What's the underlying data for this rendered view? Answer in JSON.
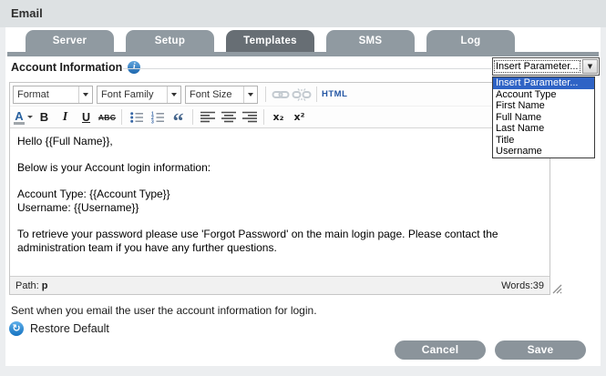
{
  "window": {
    "title": "Email"
  },
  "tabs": [
    {
      "label": "Server",
      "active": false
    },
    {
      "label": "Setup",
      "active": false
    },
    {
      "label": "Templates",
      "active": true
    },
    {
      "label": "SMS",
      "active": false
    },
    {
      "label": "Log",
      "active": false
    }
  ],
  "section": {
    "title": "Account Information"
  },
  "parameter_select": {
    "value": "Insert Parameter...",
    "options": [
      "Insert Parameter...",
      "Account Type",
      "First Name",
      "Full Name",
      "Last Name",
      "Title",
      "Username"
    ],
    "highlighted_option": "Insert Parameter..."
  },
  "editor_toolbar": {
    "format_select": "Format",
    "font_family_select": "Font Family",
    "font_size_select": "Font Size",
    "html_button": "HTML",
    "color_letter": "A",
    "bold": "B",
    "italic": "I",
    "underline": "U",
    "strikethrough": "ABC",
    "blockquote": "“",
    "subscript": "x₂",
    "superscript": "x²"
  },
  "editor": {
    "content": "Hello {{Full Name}},\n\nBelow is your Account login information:\n\nAccount Type: {{Account Type}}\nUsername: {{Username}}\n\nTo retrieve your password please use 'Forgot Password' on the main login page. Please contact the\nadministration team if you have any further questions.",
    "status_path_label": "Path: ",
    "status_path_value": "p",
    "word_count": "Words:39"
  },
  "footer": {
    "description": "Sent when you email the user the account information for login.",
    "restore_default_label": "Restore Default",
    "restore_icon_glyph": "↻",
    "cancel_button": "Cancel",
    "save_button": "Save"
  },
  "icons": {
    "info": "info-icon",
    "link": "link-icon",
    "unlink": "unlink-icon",
    "bullet_list": "bullet-list-icon",
    "numbered_list": "numbered-list-icon",
    "align_left": "align-left-icon",
    "align_center": "align-center-icon",
    "align_right": "align-right-icon",
    "resize_grip": "resize-grip-icon",
    "restore": "restore-icon"
  },
  "colors": {
    "tab_inactive": "#909aa1",
    "tab_active": "#676e74",
    "selection_blue": "#2f63c5",
    "info_icon_blue": "#1d67ae",
    "action_button_gray": "#8b949b",
    "header_bg": "#dde1e3",
    "toolbar_icon_blue": "#28619f"
  }
}
